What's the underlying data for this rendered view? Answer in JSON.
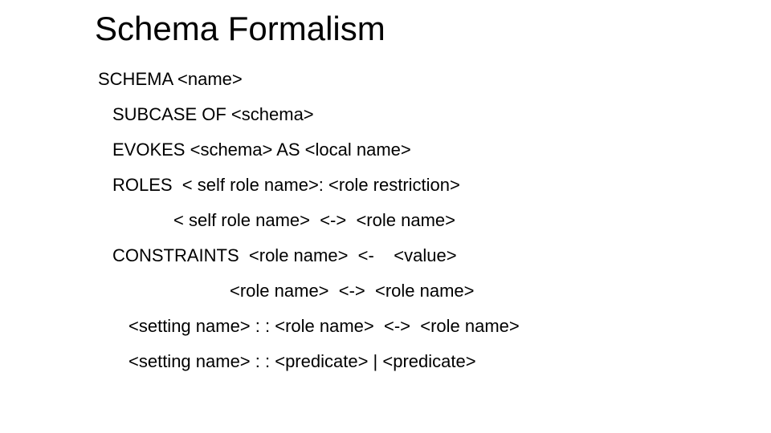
{
  "title": "Schema Formalism",
  "lines": {
    "l0": "SCHEMA <name>",
    "l1": "SUBCASE OF <schema>",
    "l2": "EVOKES <schema> AS <local name>",
    "l3": "ROLES  < self role name>: <role restriction>",
    "l4": "< self role name>  <->  <role name>",
    "l5": "CONSTRAINTS  <role name>  <-    <value>",
    "l6": "<role name>  <->  <role name>",
    "l7": "<setting name> : : <role name>  <->  <role name>",
    "l8": "<setting name> : : <predicate> | <predicate>"
  }
}
